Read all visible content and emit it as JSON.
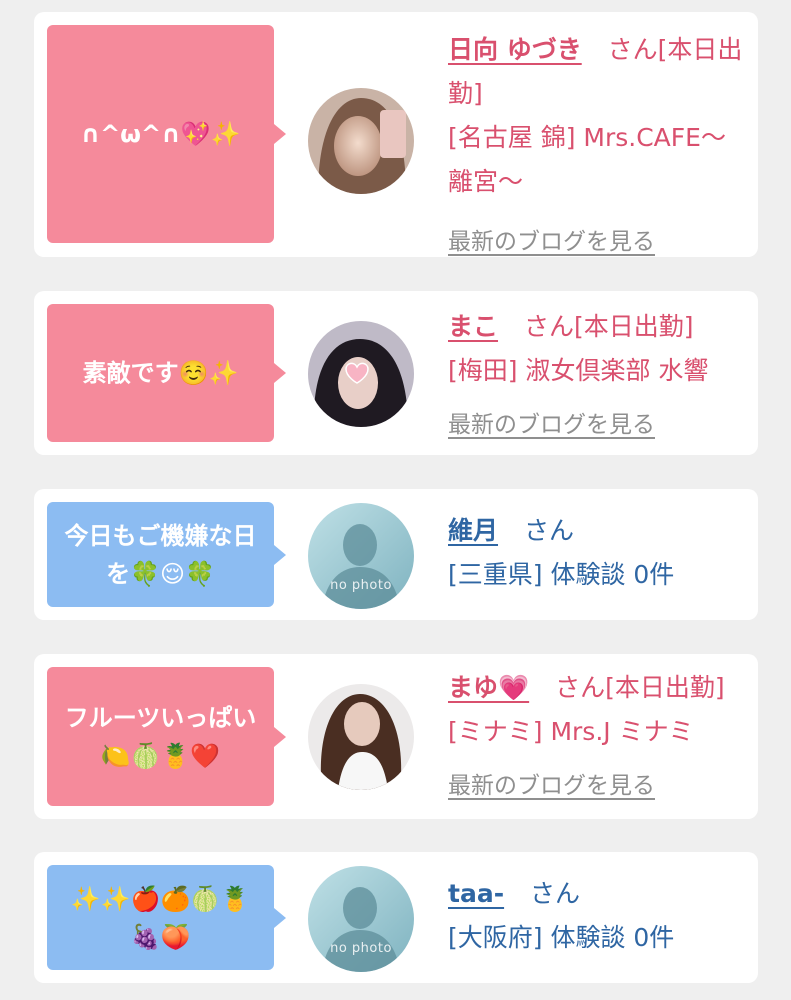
{
  "entries": [
    {
      "comment": "∩^ω^∩💖✨",
      "name": "日向 ゆづき",
      "suffix": "さん[本日出勤]",
      "shop": "[名古屋 錦] Mrs.CAFE〜離宮〜",
      "link": "最新のブログを見る",
      "theme": "pink"
    },
    {
      "comment": "素敵です☺️✨",
      "name": "まこ",
      "suffix": "さん[本日出勤]",
      "shop": "[梅田] 淑女倶楽部 水響",
      "link": "最新のブログを見る",
      "theme": "pink"
    },
    {
      "comment": "今日もご機嫌な日を🍀😌🍀",
      "name": "維月",
      "suffix": "さん",
      "shop": "[三重県] 体験談 0件",
      "theme": "blue",
      "avatar_text": "no photo"
    },
    {
      "comment": "フルーツいっぱい🍋🍈🍍❤️",
      "name": "まゆ💗",
      "suffix": "さん[本日出勤]",
      "shop": "[ミナミ] Mrs.J ミナミ",
      "link": "最新のブログを見る",
      "theme": "pink"
    },
    {
      "comment": "✨✨🍎🍊🍈🍍🍇🍑",
      "name": "taa-",
      "suffix": "さん",
      "shop": "[大阪府] 体験談 0件",
      "theme": "blue",
      "avatar_text": "no photo"
    }
  ],
  "colors": {
    "pink_bubble": "#f58a9b",
    "blue_bubble": "#8cbcf2",
    "pink_text": "#d9506e",
    "blue_text": "#2f66a3",
    "link_gray": "#8f8f8f",
    "page_bg": "#efefef"
  }
}
